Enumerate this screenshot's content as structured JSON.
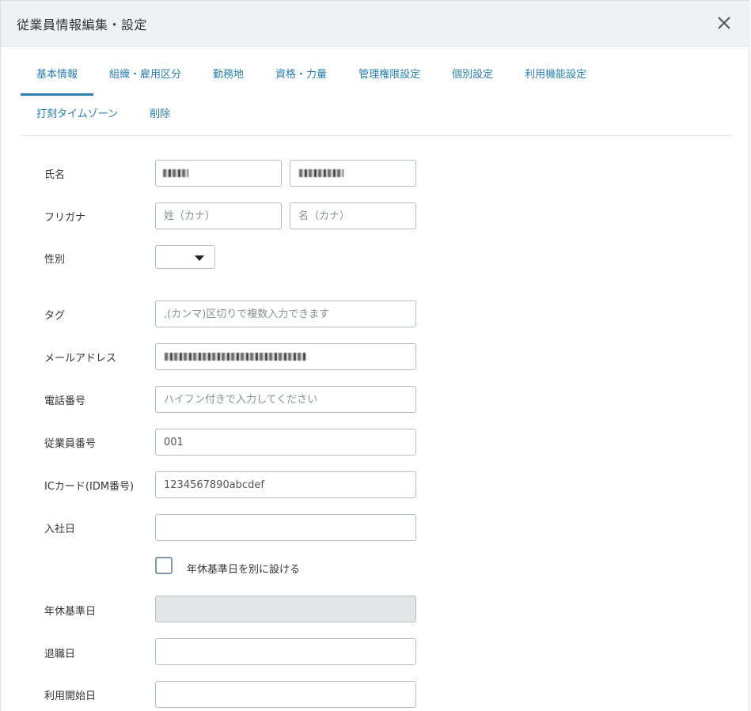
{
  "dialog": {
    "title": "従業員情報編集・設定",
    "close_icon": "close-icon"
  },
  "tabs": [
    {
      "label": "基本情報",
      "active": true
    },
    {
      "label": "組織・雇用区分",
      "active": false
    },
    {
      "label": "勤務地",
      "active": false
    },
    {
      "label": "資格・力量",
      "active": false
    },
    {
      "label": "管理権限設定",
      "active": false
    },
    {
      "label": "個別設定",
      "active": false
    },
    {
      "label": "利用機能設定",
      "active": false
    },
    {
      "label": "打刻タイムゾーン",
      "active": false
    },
    {
      "label": "削除",
      "active": false
    }
  ],
  "form": {
    "name": {
      "label": "氏名",
      "last_value": "",
      "first_value": ""
    },
    "furigana": {
      "label": "フリガナ",
      "last_placeholder": "姓（カナ）",
      "first_placeholder": "名（カナ）"
    },
    "gender": {
      "label": "性別",
      "selected": ""
    },
    "tag": {
      "label": "タグ",
      "placeholder": ",(カンマ)区切りで複数入力できます"
    },
    "email": {
      "label": "メールアドレス",
      "value": ""
    },
    "phone": {
      "label": "電話番号",
      "placeholder": "ハイフン付きで入力してください"
    },
    "employee_no": {
      "label": "従業員番号",
      "value": "001"
    },
    "ic_card": {
      "label": "ICカード(IDM番号)",
      "value": "1234567890abcdef"
    },
    "join_date": {
      "label": "入社日",
      "value": ""
    },
    "leave_base_checkbox": {
      "label": "年休基準日を別に設ける",
      "checked": false
    },
    "leave_base_date": {
      "label": "年休基準日",
      "value": ""
    },
    "retire_date": {
      "label": "退職日",
      "value": ""
    },
    "start_date": {
      "label": "利用開始日",
      "value": ""
    }
  }
}
